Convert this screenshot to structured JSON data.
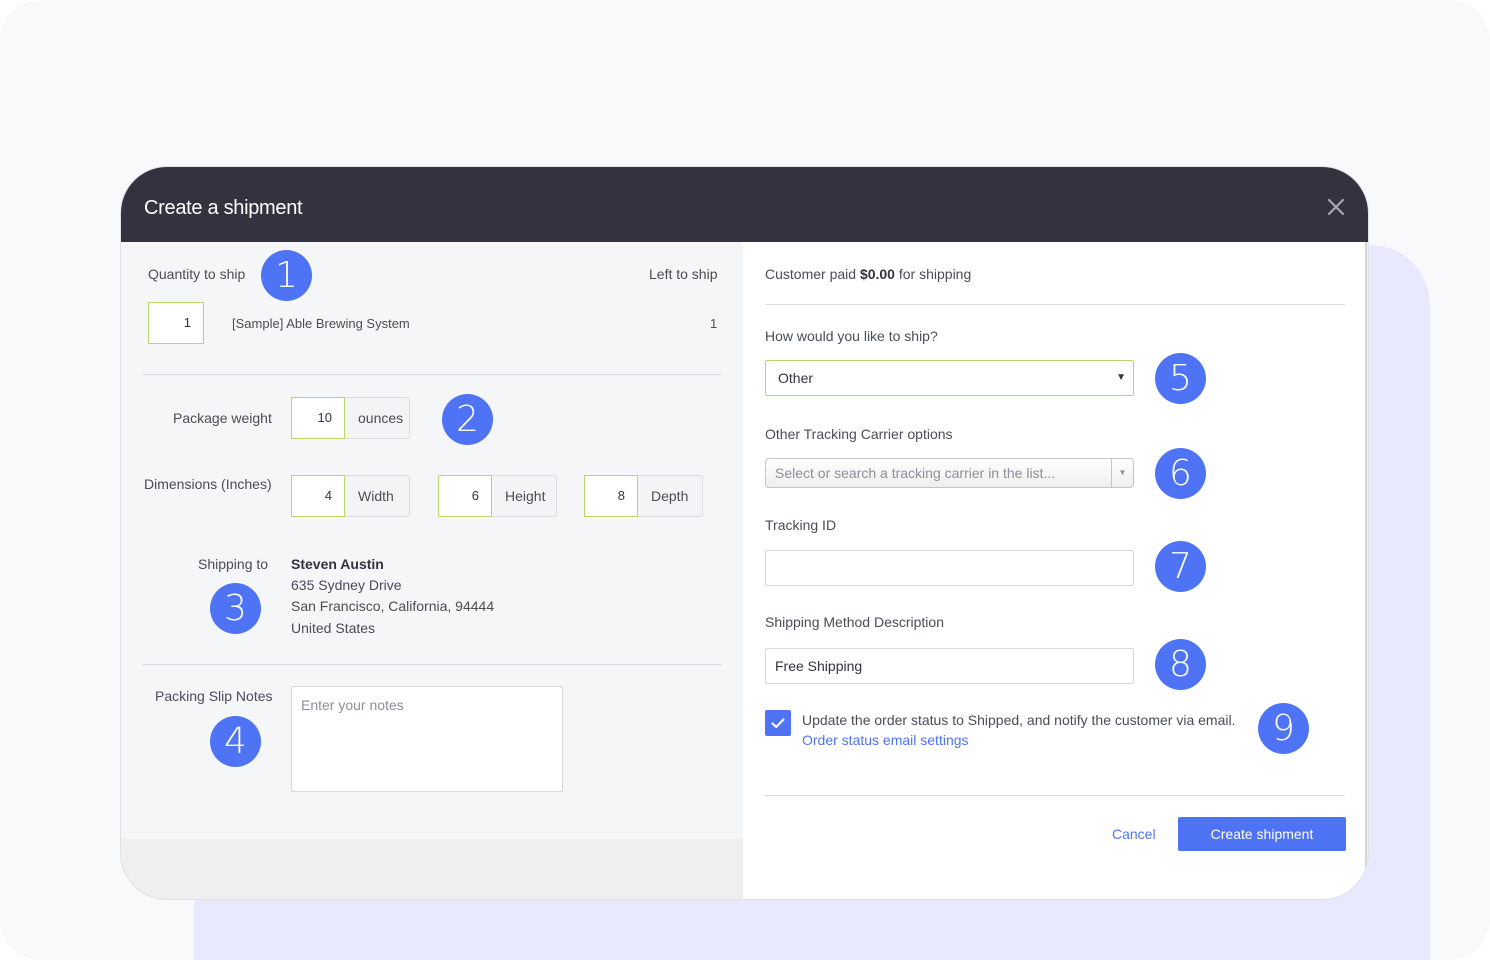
{
  "modal": {
    "title": "Create a shipment",
    "close_icon": "close-icon"
  },
  "items": {
    "quantity_label": "Quantity to ship",
    "left_label": "Left to ship",
    "rows": [
      {
        "quantity": "1",
        "name": "[Sample] Able Brewing System",
        "left": "1"
      }
    ]
  },
  "package": {
    "weight_label": "Package weight",
    "weight_value": "10",
    "weight_unit": "ounces",
    "dimensions_label": "Dimensions (Inches)",
    "width_value": "4",
    "width_label": "Width",
    "height_value": "6",
    "height_label": "Height",
    "depth_value": "8",
    "depth_label": "Depth"
  },
  "shipping_to": {
    "label": "Shipping to",
    "name": "Steven Austin",
    "street": "635 Sydney Drive",
    "city_line": "San Francisco, California, 94444",
    "country": "United States"
  },
  "notes": {
    "label": "Packing Slip Notes",
    "placeholder": "Enter your notes",
    "value": ""
  },
  "right": {
    "customer_paid_prefix": "Customer paid",
    "customer_paid_amount": "$0.00",
    "customer_paid_suffix": "for shipping",
    "ship_method_label": "How would you like to ship?",
    "ship_method_value": "Other",
    "carrier_label": "Other Tracking Carrier options",
    "carrier_placeholder": "Select or search a tracking carrier in the list...",
    "tracking_label": "Tracking ID",
    "tracking_value": "",
    "description_label": "Shipping Method Description",
    "description_value": "Free Shipping",
    "notify_checked": true,
    "notify_text": "Update the order status to Shipped, and notify the customer via email.",
    "notify_link": "Order status email settings"
  },
  "footer": {
    "cancel_label": "Cancel",
    "submit_label": "Create shipment"
  },
  "callouts": [
    "1",
    "2",
    "3",
    "4",
    "5",
    "6",
    "7",
    "8",
    "9"
  ],
  "colors": {
    "accent": "#4e74f5",
    "header_bg": "#34323f",
    "focus_border": "#b5d86a"
  }
}
